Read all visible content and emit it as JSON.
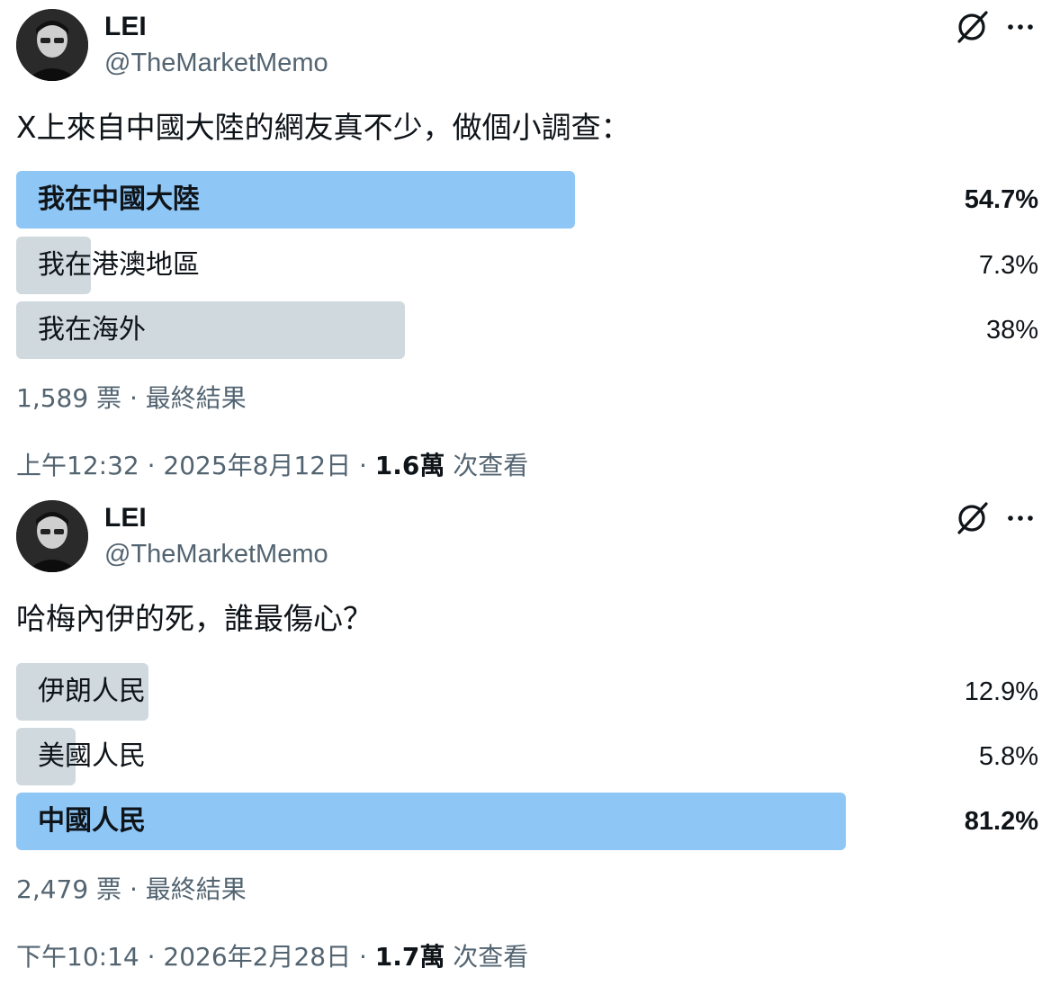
{
  "posts": [
    {
      "author": {
        "name": "LEI",
        "handle": "@TheMarketMemo"
      },
      "question": "X上來自中國大陸的網友真不少，做個小調查：",
      "options": [
        {
          "label": "我在中國大陸",
          "percent_text": "54.7%",
          "percent": 54.7,
          "winner": true
        },
        {
          "label": "我在港澳地區",
          "percent_text": "7.3%",
          "percent": 7.3,
          "winner": false
        },
        {
          "label": "我在海外",
          "percent_text": "38%",
          "percent": 38,
          "winner": false
        }
      ],
      "votes_text": "1,589 票 · 最終結果",
      "timestamp": "上午12:32 · 2025年8月12日 · ",
      "views_count": "1.6萬",
      "views_suffix": " 次查看"
    },
    {
      "author": {
        "name": "LEI",
        "handle": "@TheMarketMemo"
      },
      "question": "哈梅內伊的死，誰最傷心？",
      "options": [
        {
          "label": "伊朗人民",
          "percent_text": "12.9%",
          "percent": 12.9,
          "winner": false
        },
        {
          "label": "美國人民",
          "percent_text": "5.8%",
          "percent": 5.8,
          "winner": false
        },
        {
          "label": "中國人民",
          "percent_text": "81.2%",
          "percent": 81.2,
          "winner": true
        }
      ],
      "votes_text": "2,479 票 · 最終結果",
      "timestamp": "下午10:14 · 2026年2月28日 · ",
      "views_count": "1.7萬",
      "views_suffix": " 次查看"
    }
  ],
  "icons": {
    "grok": "grok-icon",
    "more": "more-icon"
  },
  "colors": {
    "winner_bar": "#8ec6f6",
    "other_bar": "#cfd9de",
    "secondary_text": "#536471",
    "primary_text": "#0f1419"
  }
}
